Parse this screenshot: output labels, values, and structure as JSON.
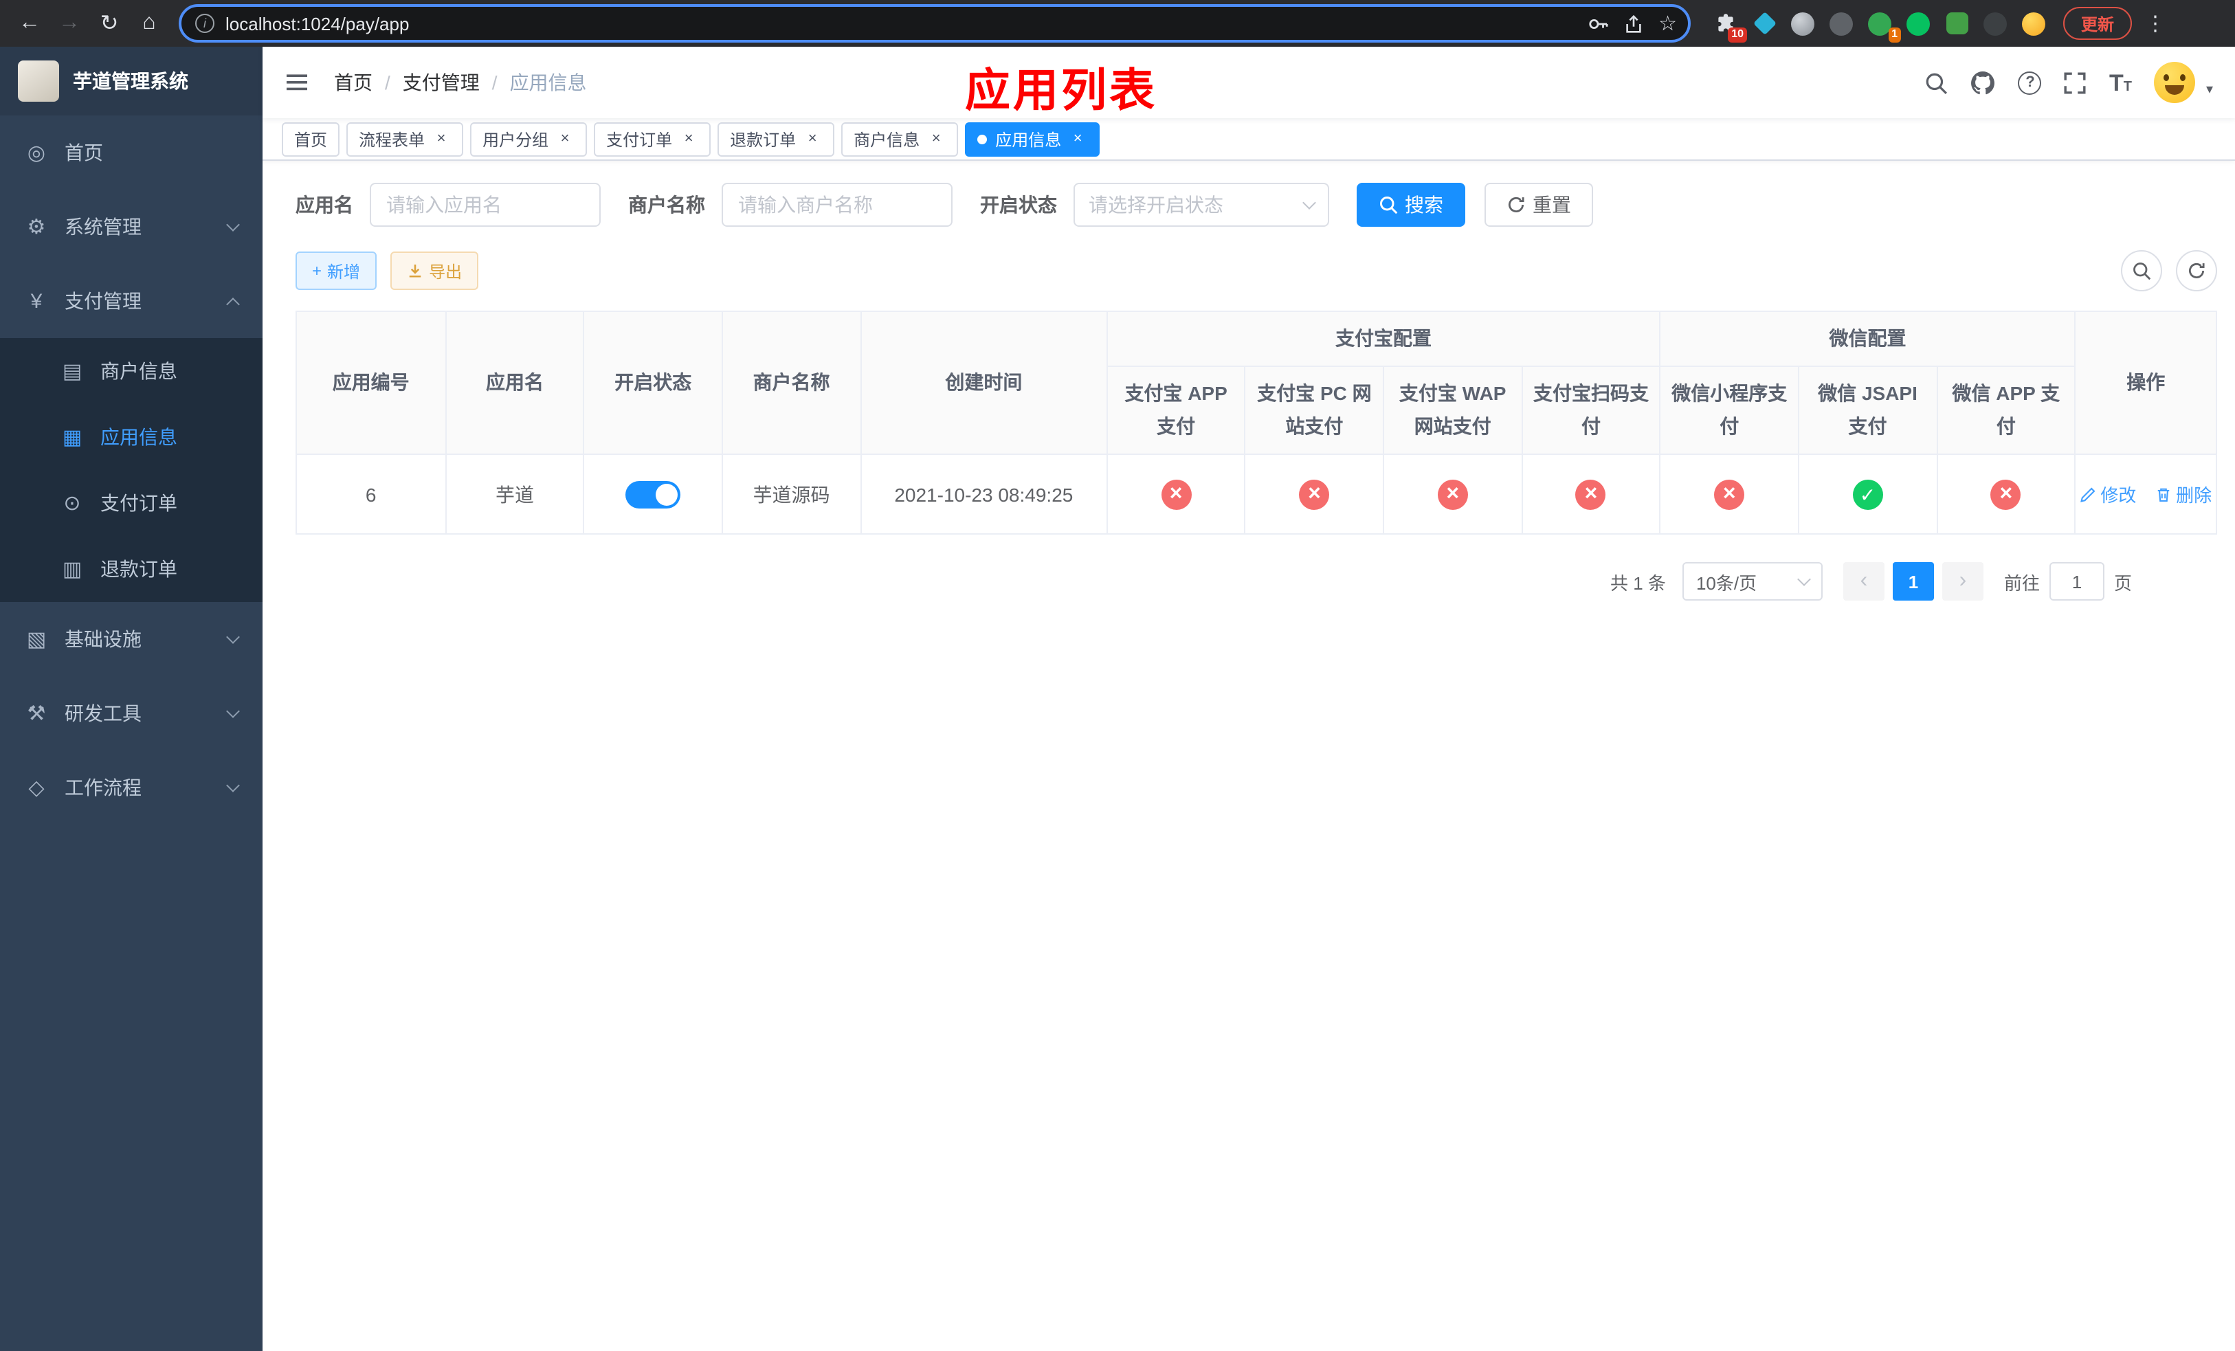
{
  "browser": {
    "url": "localhost:1024/pay/app",
    "update_label": "更新",
    "extensions_badge": "10",
    "extension_badge_2": "1"
  },
  "icons": {
    "back": "←",
    "forward": "→",
    "reload": "↻",
    "home": "⌂",
    "info": "i",
    "star": "☆",
    "menu_dots": "⋮",
    "caret_down": "▾",
    "dashboard": "◎",
    "gear": "⚙",
    "yen": "¥",
    "merchant": "▤",
    "app": "▦",
    "order": "⊙",
    "refund": "▥",
    "infra": "▧",
    "tools": "⚒",
    "workflow": "◇",
    "plus": "+",
    "help": "?",
    "font": "T",
    "prev": "‹",
    "next": "›"
  },
  "sidebar": {
    "title": "芋道管理系统",
    "items": {
      "home": "首页",
      "system": "系统管理",
      "payment": "支付管理",
      "merchant_info": "商户信息",
      "app_info": "应用信息",
      "pay_order": "支付订单",
      "refund_order": "退款订单",
      "infra": "基础设施",
      "dev_tools": "研发工具",
      "workflow": "工作流程"
    }
  },
  "header": {
    "breadcrumb": [
      "首页",
      "支付管理",
      "应用信息"
    ],
    "separator": "/",
    "title": "应用列表"
  },
  "tabs": [
    {
      "label": "首页",
      "active": false,
      "closable": false
    },
    {
      "label": "流程表单",
      "active": false,
      "closable": true
    },
    {
      "label": "用户分组",
      "active": false,
      "closable": true
    },
    {
      "label": "支付订单",
      "active": false,
      "closable": true
    },
    {
      "label": "退款订单",
      "active": false,
      "closable": true
    },
    {
      "label": "商户信息",
      "active": false,
      "closable": true
    },
    {
      "label": "应用信息",
      "active": true,
      "closable": true
    }
  ],
  "filters": {
    "app_name_label": "应用名",
    "app_name_placeholder": "请输入应用名",
    "merchant_label": "商户名称",
    "merchant_placeholder": "请输入商户名称",
    "status_label": "开启状态",
    "status_placeholder": "请选择开启状态",
    "search_label": "搜索",
    "reset_label": "重置"
  },
  "toolbar": {
    "add_label": "新增",
    "export_label": "导出"
  },
  "table": {
    "headers": {
      "app_id": "应用编号",
      "app_name": "应用名",
      "status": "开启状态",
      "merchant_name": "商户名称",
      "create_time": "创建时间",
      "alipay_group": "支付宝配置",
      "wechat_group": "微信配置",
      "alipay_app": "支付宝 APP 支付",
      "alipay_pc": "支付宝 PC 网站支付",
      "alipay_wap": "支付宝 WAP 网站支付",
      "alipay_qr": "支付宝扫码支付",
      "wechat_mini": "微信小程序支付",
      "wechat_jsapi": "微信 JSAPI 支付",
      "wechat_app": "微信 APP 支付",
      "actions": "操作"
    },
    "rows": [
      {
        "app_id": "6",
        "app_name": "芋道",
        "enabled": true,
        "merchant_name": "芋道源码",
        "create_time": "2021-10-23 08:49:25",
        "alipay_app": false,
        "alipay_pc": false,
        "alipay_wap": false,
        "alipay_qr": false,
        "wechat_mini": false,
        "wechat_jsapi": true,
        "wechat_app": false
      }
    ],
    "row_actions": {
      "edit": "修改",
      "delete": "删除"
    }
  },
  "pagination": {
    "total": "共 1 条",
    "page_size": "10条/页",
    "page": "1",
    "goto_label": "前往",
    "goto_value": "1",
    "goto_unit": "页"
  }
}
